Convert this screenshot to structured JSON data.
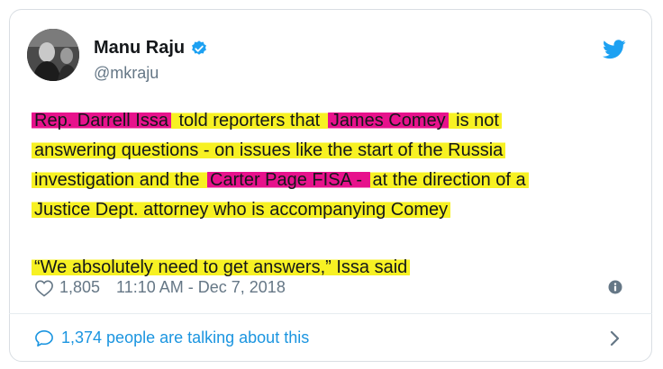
{
  "author": {
    "name": "Manu Raju",
    "handle": "@mkraju"
  },
  "tweet": {
    "lines": [
      [
        {
          "text": "Rep. Darrell Issa",
          "hl": "pink"
        },
        {
          "text": " told reporters that ",
          "hl": "yellow"
        },
        {
          "text": "James Comey",
          "hl": "pink"
        },
        {
          "text": " is not",
          "hl": "yellow"
        }
      ],
      [
        {
          "text": "answering questions - on issues like the start of the Russia",
          "hl": "yellow"
        }
      ],
      [
        {
          "text": "investigation and the ",
          "hl": "yellow"
        },
        {
          "text": "Carter Page FISA - ",
          "hl": "pink"
        },
        {
          "text": "at the direction of a",
          "hl": "yellow"
        }
      ],
      [
        {
          "text": "Justice Dept. attorney who is accompanying Comey",
          "hl": "yellow"
        }
      ]
    ],
    "quote": "“We absolutely need to get answers,” Issa said"
  },
  "meta": {
    "likes": "1,805",
    "timestamp": "11:10 AM - Dec 7, 2018"
  },
  "footer": {
    "talking": "1,374 people are talking about this"
  },
  "colors": {
    "highlight_yellow": "#f7f123",
    "highlight_pink": "#e7128c",
    "twitter_blue": "#1da1f2",
    "link_blue": "#1b95e0"
  },
  "icons": [
    "avatar-photo",
    "verified-badge-icon",
    "twitter-bird-icon",
    "heart-icon",
    "info-icon",
    "speech-bubble-icon",
    "chevron-right-icon"
  ]
}
